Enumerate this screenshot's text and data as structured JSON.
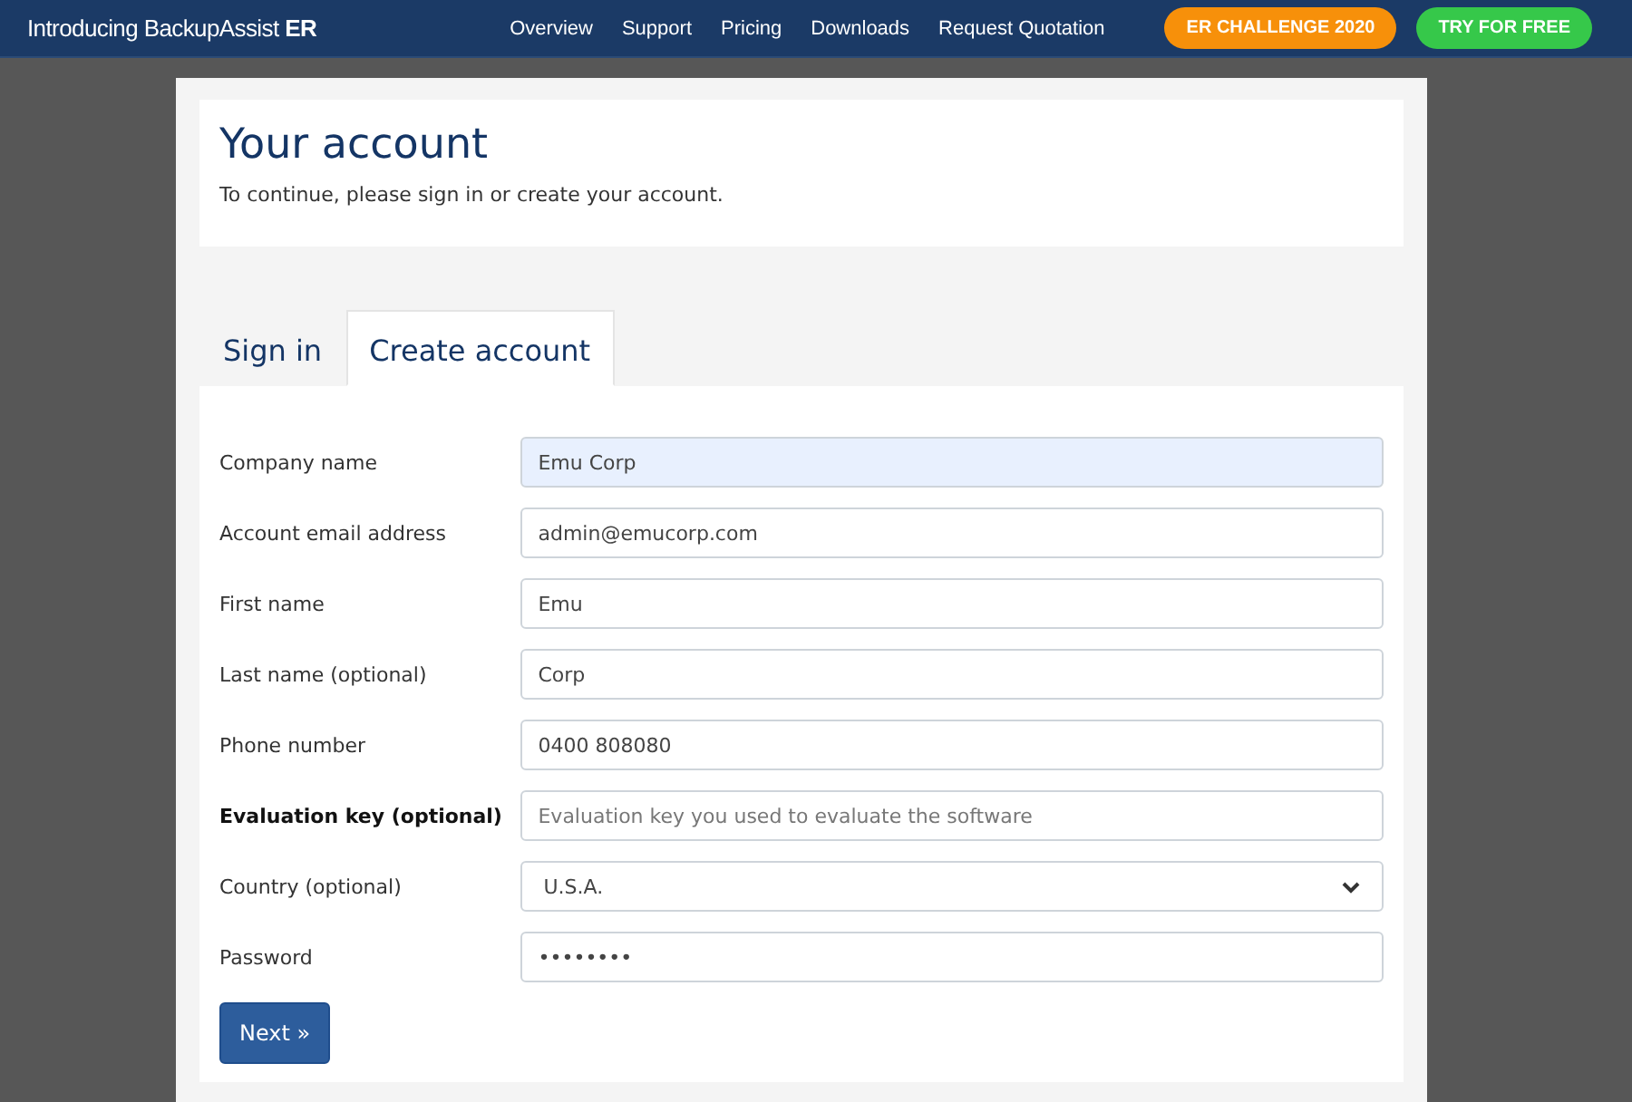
{
  "topbar": {
    "brand": "Introducing BackupAssist **ER**",
    "nav": [
      "Overview",
      "Support",
      "Pricing",
      "Downloads",
      "Request Quotation"
    ],
    "buttons": [
      {
        "label": "ER CHALLENGE 2020",
        "kind": "orange"
      },
      {
        "label": "TRY FOR FREE",
        "kind": "green"
      }
    ]
  },
  "header": {
    "title": "Your account",
    "subtitle": "To continue, please sign in or create your account."
  },
  "tabs": [
    {
      "label": "Sign in",
      "selected": false
    },
    {
      "label": "Create account",
      "selected": true
    }
  ],
  "form": {
    "fields": [
      {
        "label": "Company name",
        "kind": "text",
        "value": "Emu Corp",
        "autofilled": true,
        "emphasized": false
      },
      {
        "label": "Account email address",
        "kind": "text",
        "value": "admin@emucorp.com",
        "autofilled": false,
        "emphasized": false
      },
      {
        "label": "First name",
        "kind": "text",
        "value": "Emu",
        "autofilled": false,
        "emphasized": false
      },
      {
        "label": "Last name (optional)",
        "kind": "text",
        "value": "Corp",
        "autofilled": false,
        "emphasized": false
      },
      {
        "label": "Phone number",
        "kind": "text",
        "value": "0400 808080",
        "autofilled": false,
        "emphasized": false
      },
      {
        "label": "Evaluation key (optional)",
        "kind": "text",
        "placeholder": "Evaluation key you used to evaluate the software",
        "autofilled": false,
        "emphasized": true
      },
      {
        "label": "Country (optional)",
        "kind": "select",
        "value": "U.S.A.",
        "autofilled": false,
        "emphasized": false
      },
      {
        "label": "Password",
        "kind": "text",
        "value": "••••••••",
        "autofilled": false,
        "emphasized": false
      }
    ],
    "submit": "Next »"
  }
}
